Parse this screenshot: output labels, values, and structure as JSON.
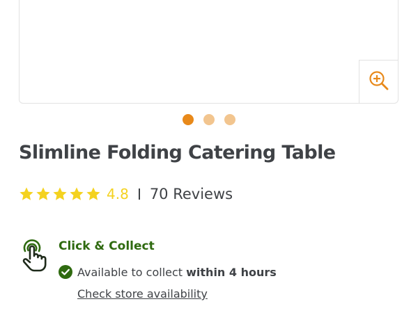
{
  "product": {
    "title": "Slimline Folding Catering Table",
    "rating": {
      "score": "4.8",
      "stars": 5,
      "reviews": "70 Reviews"
    }
  },
  "gallery": {
    "image_count": 3,
    "active_index": 0,
    "zoom_icon": "zoom-in-icon"
  },
  "click_collect": {
    "icon": "tap-hand-icon",
    "title": "Click & Collect",
    "availability_prefix": "Available to collect",
    "availability_bold": "within 4 hours",
    "link": "Check store availability"
  },
  "colors": {
    "accent_orange": "#e8891a",
    "dot_inactive": "#f2c58f",
    "star_yellow": "#f4d21f",
    "brand_green": "#2f6a10",
    "text_dark": "#3f4246",
    "border": "#e2e2e2"
  }
}
